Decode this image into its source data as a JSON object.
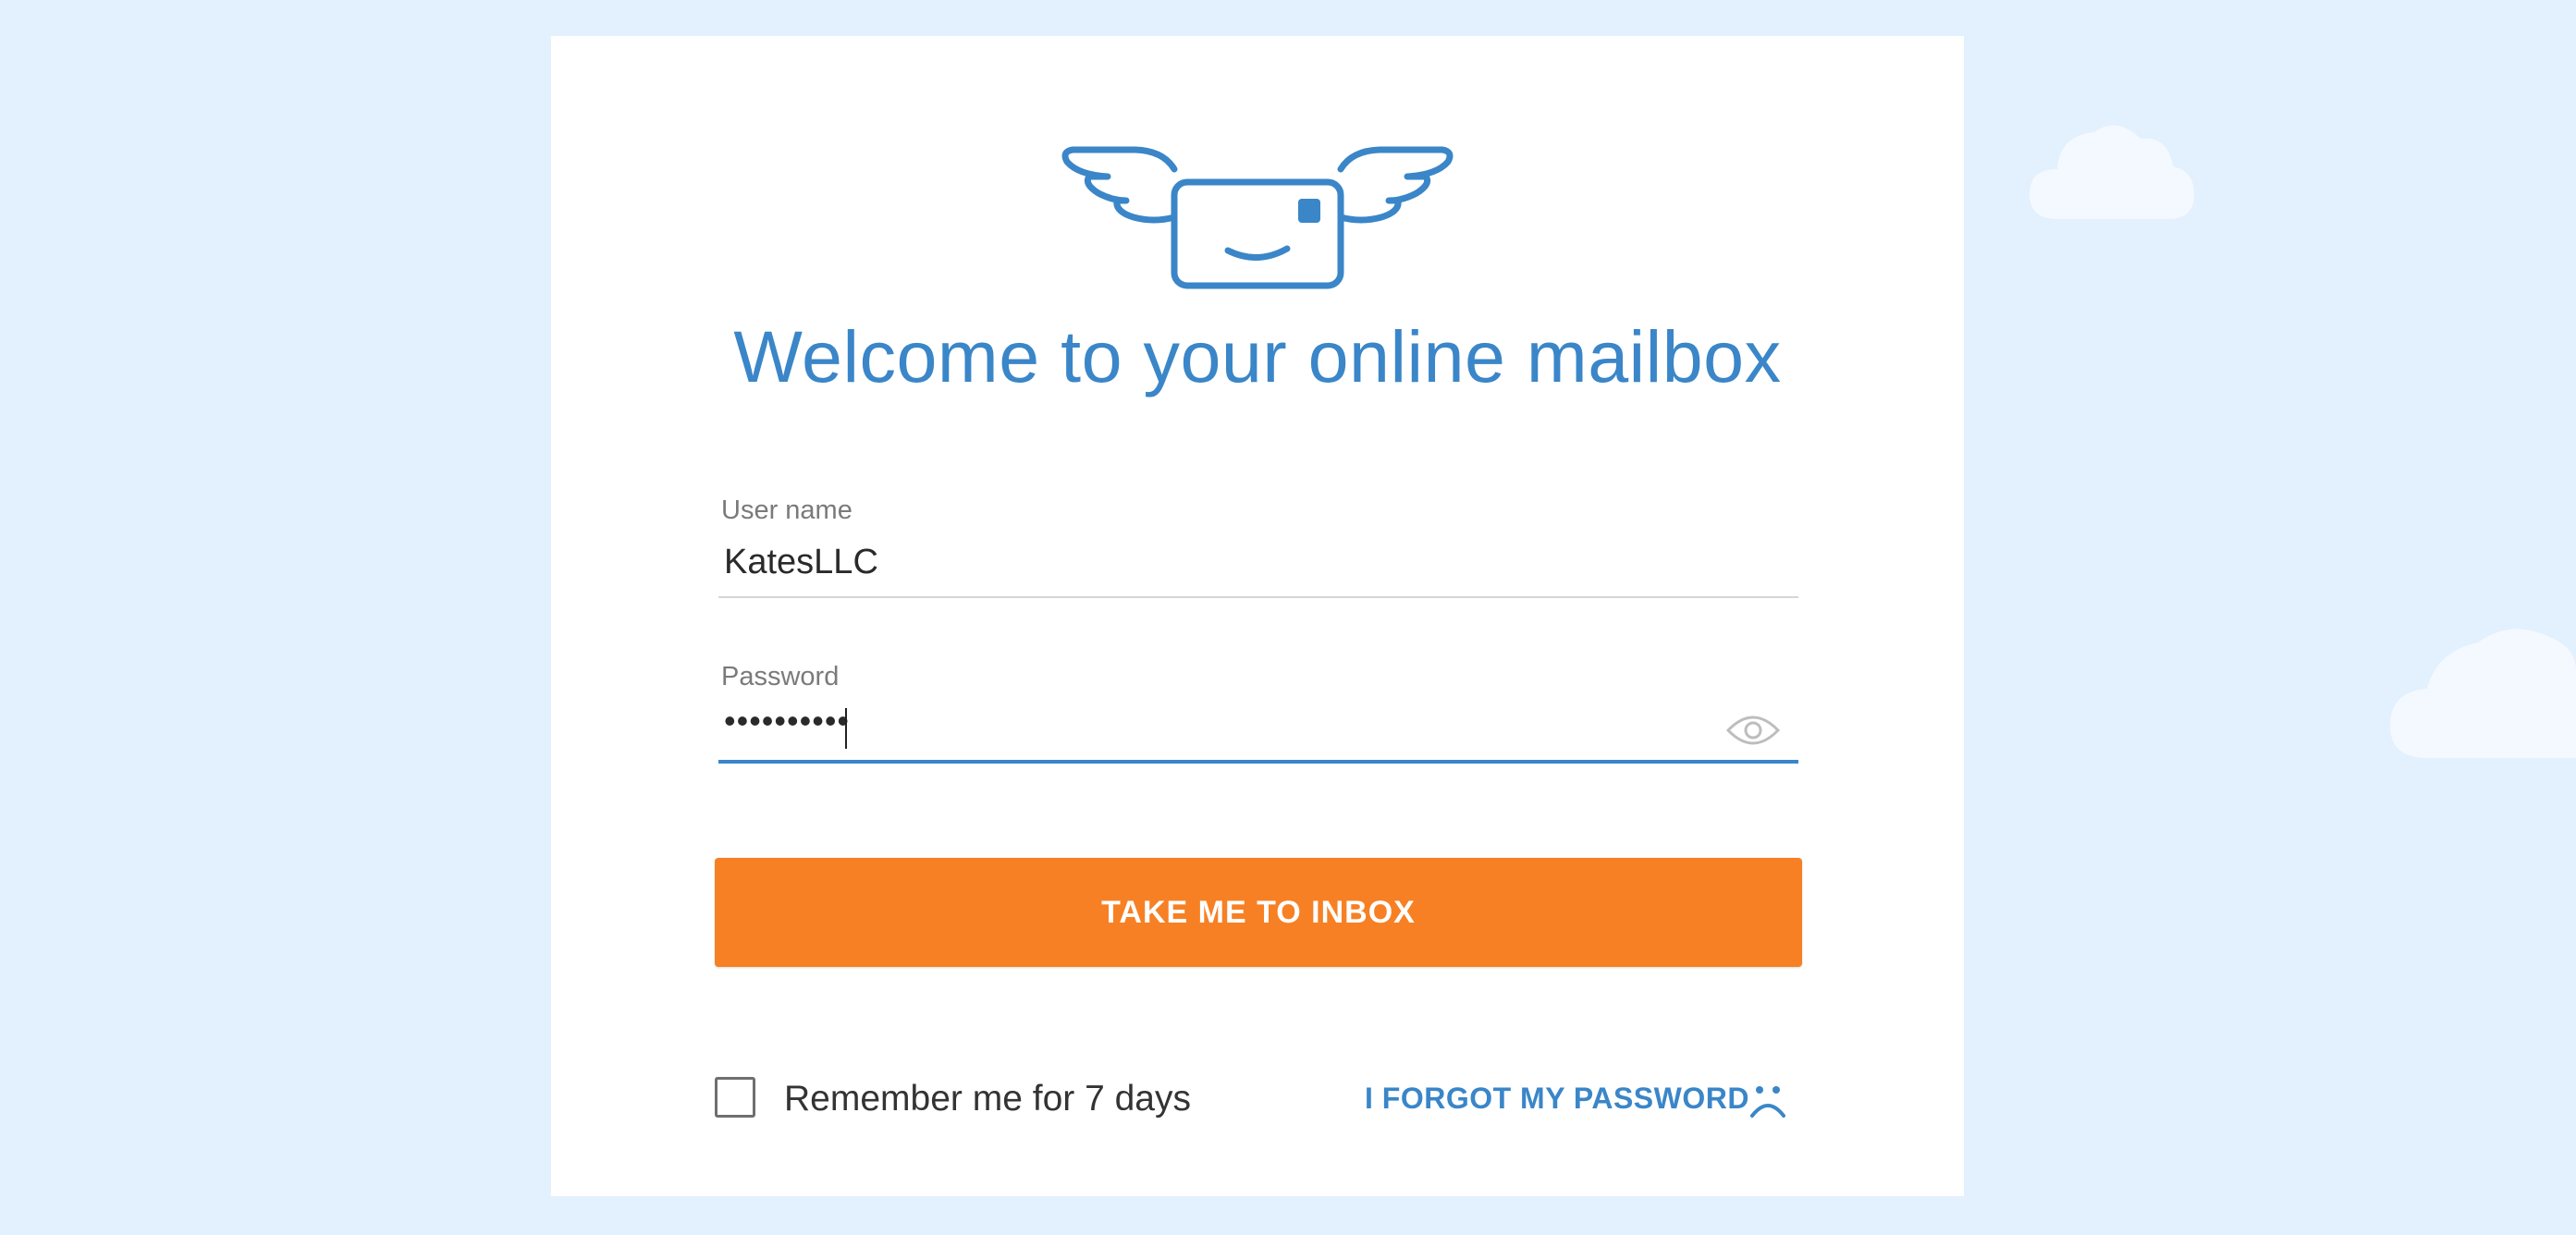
{
  "page": {
    "title": "Welcome to your online mailbox"
  },
  "form": {
    "username_label": "User name",
    "username_value": "KatesLLC",
    "password_label": "Password",
    "password_value": "••••••••••"
  },
  "actions": {
    "submit_label": "TAKE ME TO INBOX",
    "remember_label": "Remember me for 7 days",
    "remember_checked": false,
    "forgot_label": "I FORGOT MY PASSWORD"
  },
  "icons": {
    "logo": "winged-envelope-logo-icon",
    "password_toggle": "eye-icon",
    "forgot": "sad-face-icon",
    "decoration": "cloud-icon"
  },
  "colors": {
    "background": "#e3f0fd",
    "accent_blue": "#3a86c8",
    "cta_orange": "#f78024",
    "cloud": "#f4f9ff"
  }
}
